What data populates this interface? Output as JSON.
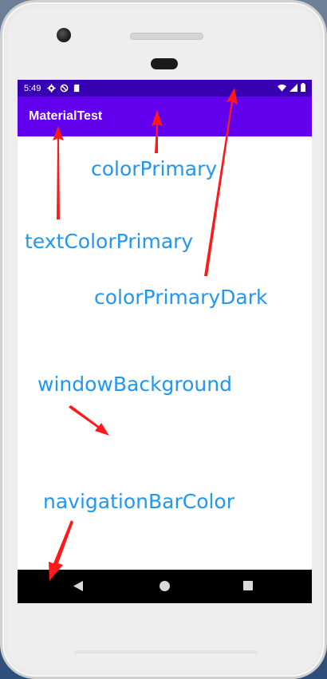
{
  "status_bar": {
    "time": "5:49",
    "color": "#3700b3"
  },
  "app_bar": {
    "title": "MaterialTest",
    "color": "#6200ee"
  },
  "annotations": {
    "color_primary": "colorPrimary",
    "text_color_primary": "textColorPrimary",
    "color_primary_dark": "colorPrimaryDark",
    "window_background": "windowBackground",
    "navigation_bar_color": "navigationBarColor",
    "label_color": "#2196f3",
    "arrow_color": "#ff1a1a"
  },
  "nav_bar": {
    "buttons": [
      "back-icon",
      "home-icon",
      "recents-icon"
    ],
    "color": "#000000"
  }
}
